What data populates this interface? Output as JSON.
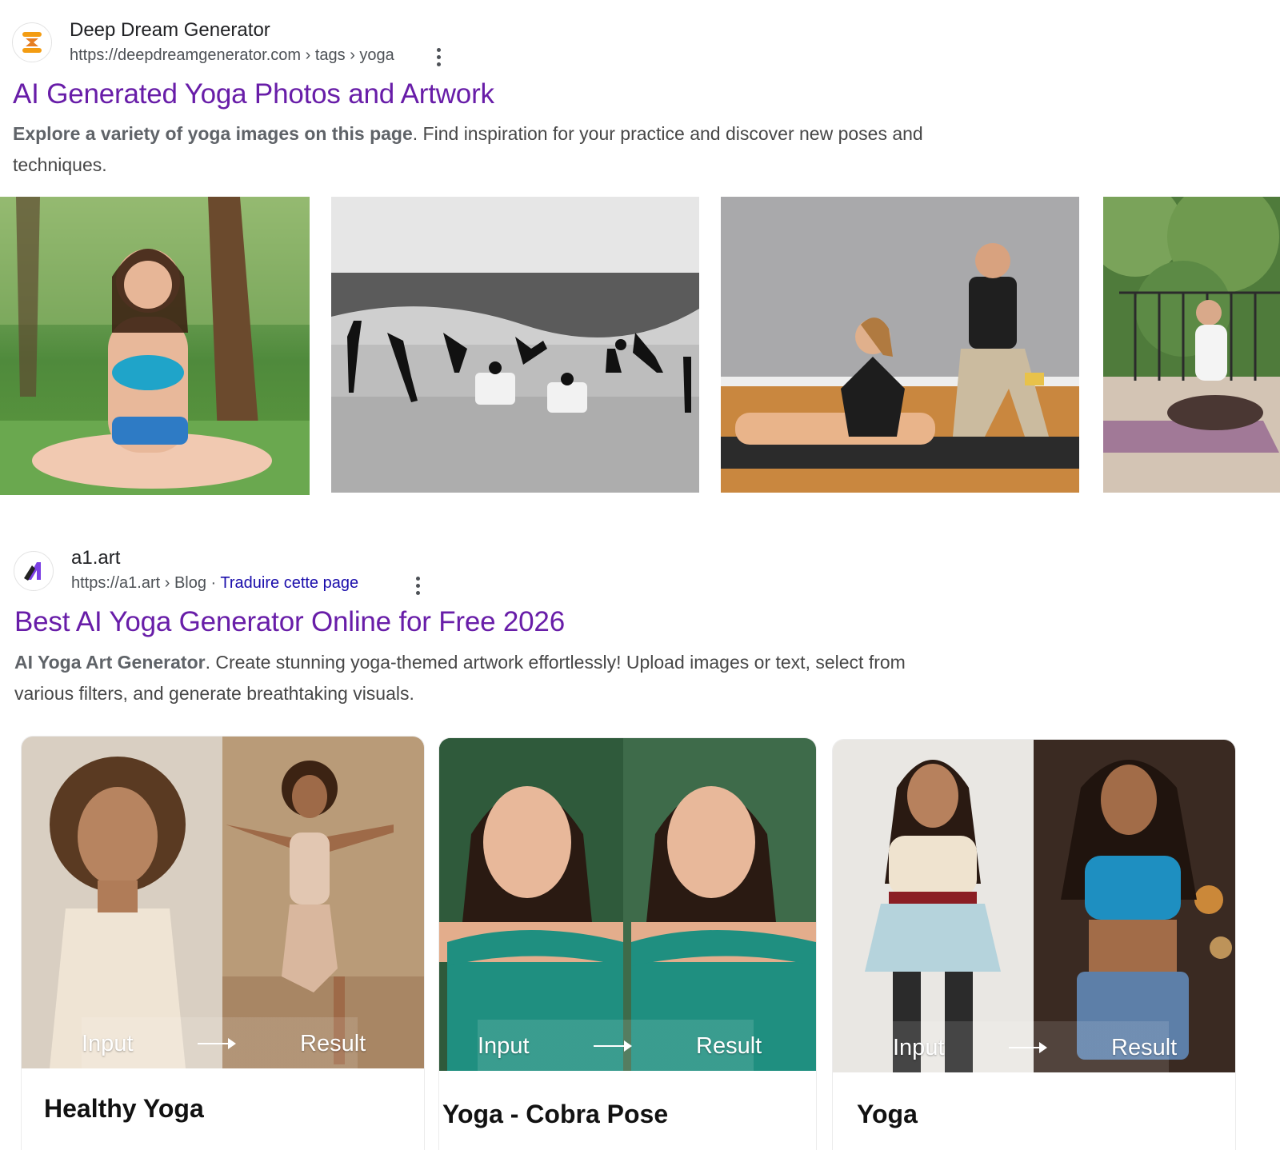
{
  "results": [
    {
      "site_name": "Deep Dream Generator",
      "url": "https://deepdreamgenerator.com › tags › yoga",
      "title": "AI Generated Yoga Photos and Artwork",
      "snippet_bold": "Explore a variety of yoga images on this page",
      "snippet_rest": ". Find inspiration for your practice and discover new poses and techniques.",
      "favicon_icon": "deep-dream-logo",
      "favicon_color": "#f39c12"
    },
    {
      "site_name": "a1.art",
      "url": "https://a1.art › Blog",
      "translate_label": "Traduire cette page",
      "title": "Best AI Yoga Generator Online for Free 2026",
      "snippet_bold": "AI Yoga Art Generator",
      "snippet_rest": ". Create stunning yoga-themed artwork effortlessly! Upload images or text, select from various filters, and generate breathtaking visuals.",
      "favicon_icon": "a1-logo",
      "favicon_color": "#7b3fe4",
      "cards": [
        {
          "title": "Healthy Yoga",
          "input_label": "Input",
          "result_label": "Result"
        },
        {
          "title": "Yoga - Cobra Pose",
          "input_label": "Input",
          "result_label": "Result"
        },
        {
          "title": "Yoga",
          "input_label": "Input",
          "result_label": "Result"
        }
      ]
    }
  ],
  "colors": {
    "visited_title": "#681da8",
    "url_text": "#4d5156",
    "link_blue": "#1a0dab"
  }
}
